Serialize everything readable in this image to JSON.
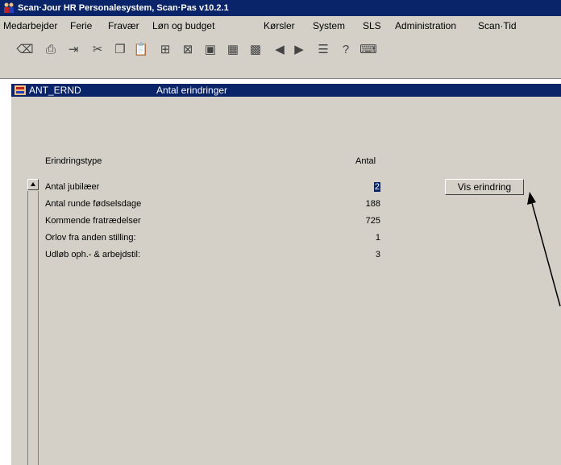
{
  "window": {
    "title": "Scan·Jour HR Personalesystem, Scan·Pas  v10.2.1"
  },
  "menu": [
    {
      "label": "Medarbejder"
    },
    {
      "label": "Ferie"
    },
    {
      "label": "Fravær"
    },
    {
      "label": "Løn og budget"
    },
    {
      "label": "Kørsler"
    },
    {
      "label": "System"
    },
    {
      "label": "SLS"
    },
    {
      "label": "Administration"
    },
    {
      "label": "Scan·Tid"
    }
  ],
  "toolbar": {
    "icons": [
      "eraser-icon",
      "print-icon",
      "exit-icon",
      "cut-icon",
      "copy-icon",
      "paste-icon",
      "add-record-icon",
      "delete-record-icon",
      "query-icon",
      "query-all-icon",
      "query-clear-icon",
      "previous-icon",
      "next-icon",
      "list-icon",
      "help-icon",
      "keyboard-icon"
    ]
  },
  "form": {
    "code": "ANT_ERND",
    "title": "Antal erindringer",
    "col_type": "Erindringstype",
    "col_count": "Antal",
    "rows": [
      {
        "label": "Antal jubilæer",
        "value": "2"
      },
      {
        "label": "Antal runde fødselsdage",
        "value": "188"
      },
      {
        "label": "Kommende fratrædelser",
        "value": "725"
      },
      {
        "label": "Orlov fra anden stilling:",
        "value": "1"
      },
      {
        "label": "Udløb oph.- & arbejdstil:",
        "value": "3"
      }
    ],
    "button_label": "Vis erindring"
  },
  "colors": {
    "titlebar": "#0a246a",
    "face": "#d4d0c8"
  }
}
